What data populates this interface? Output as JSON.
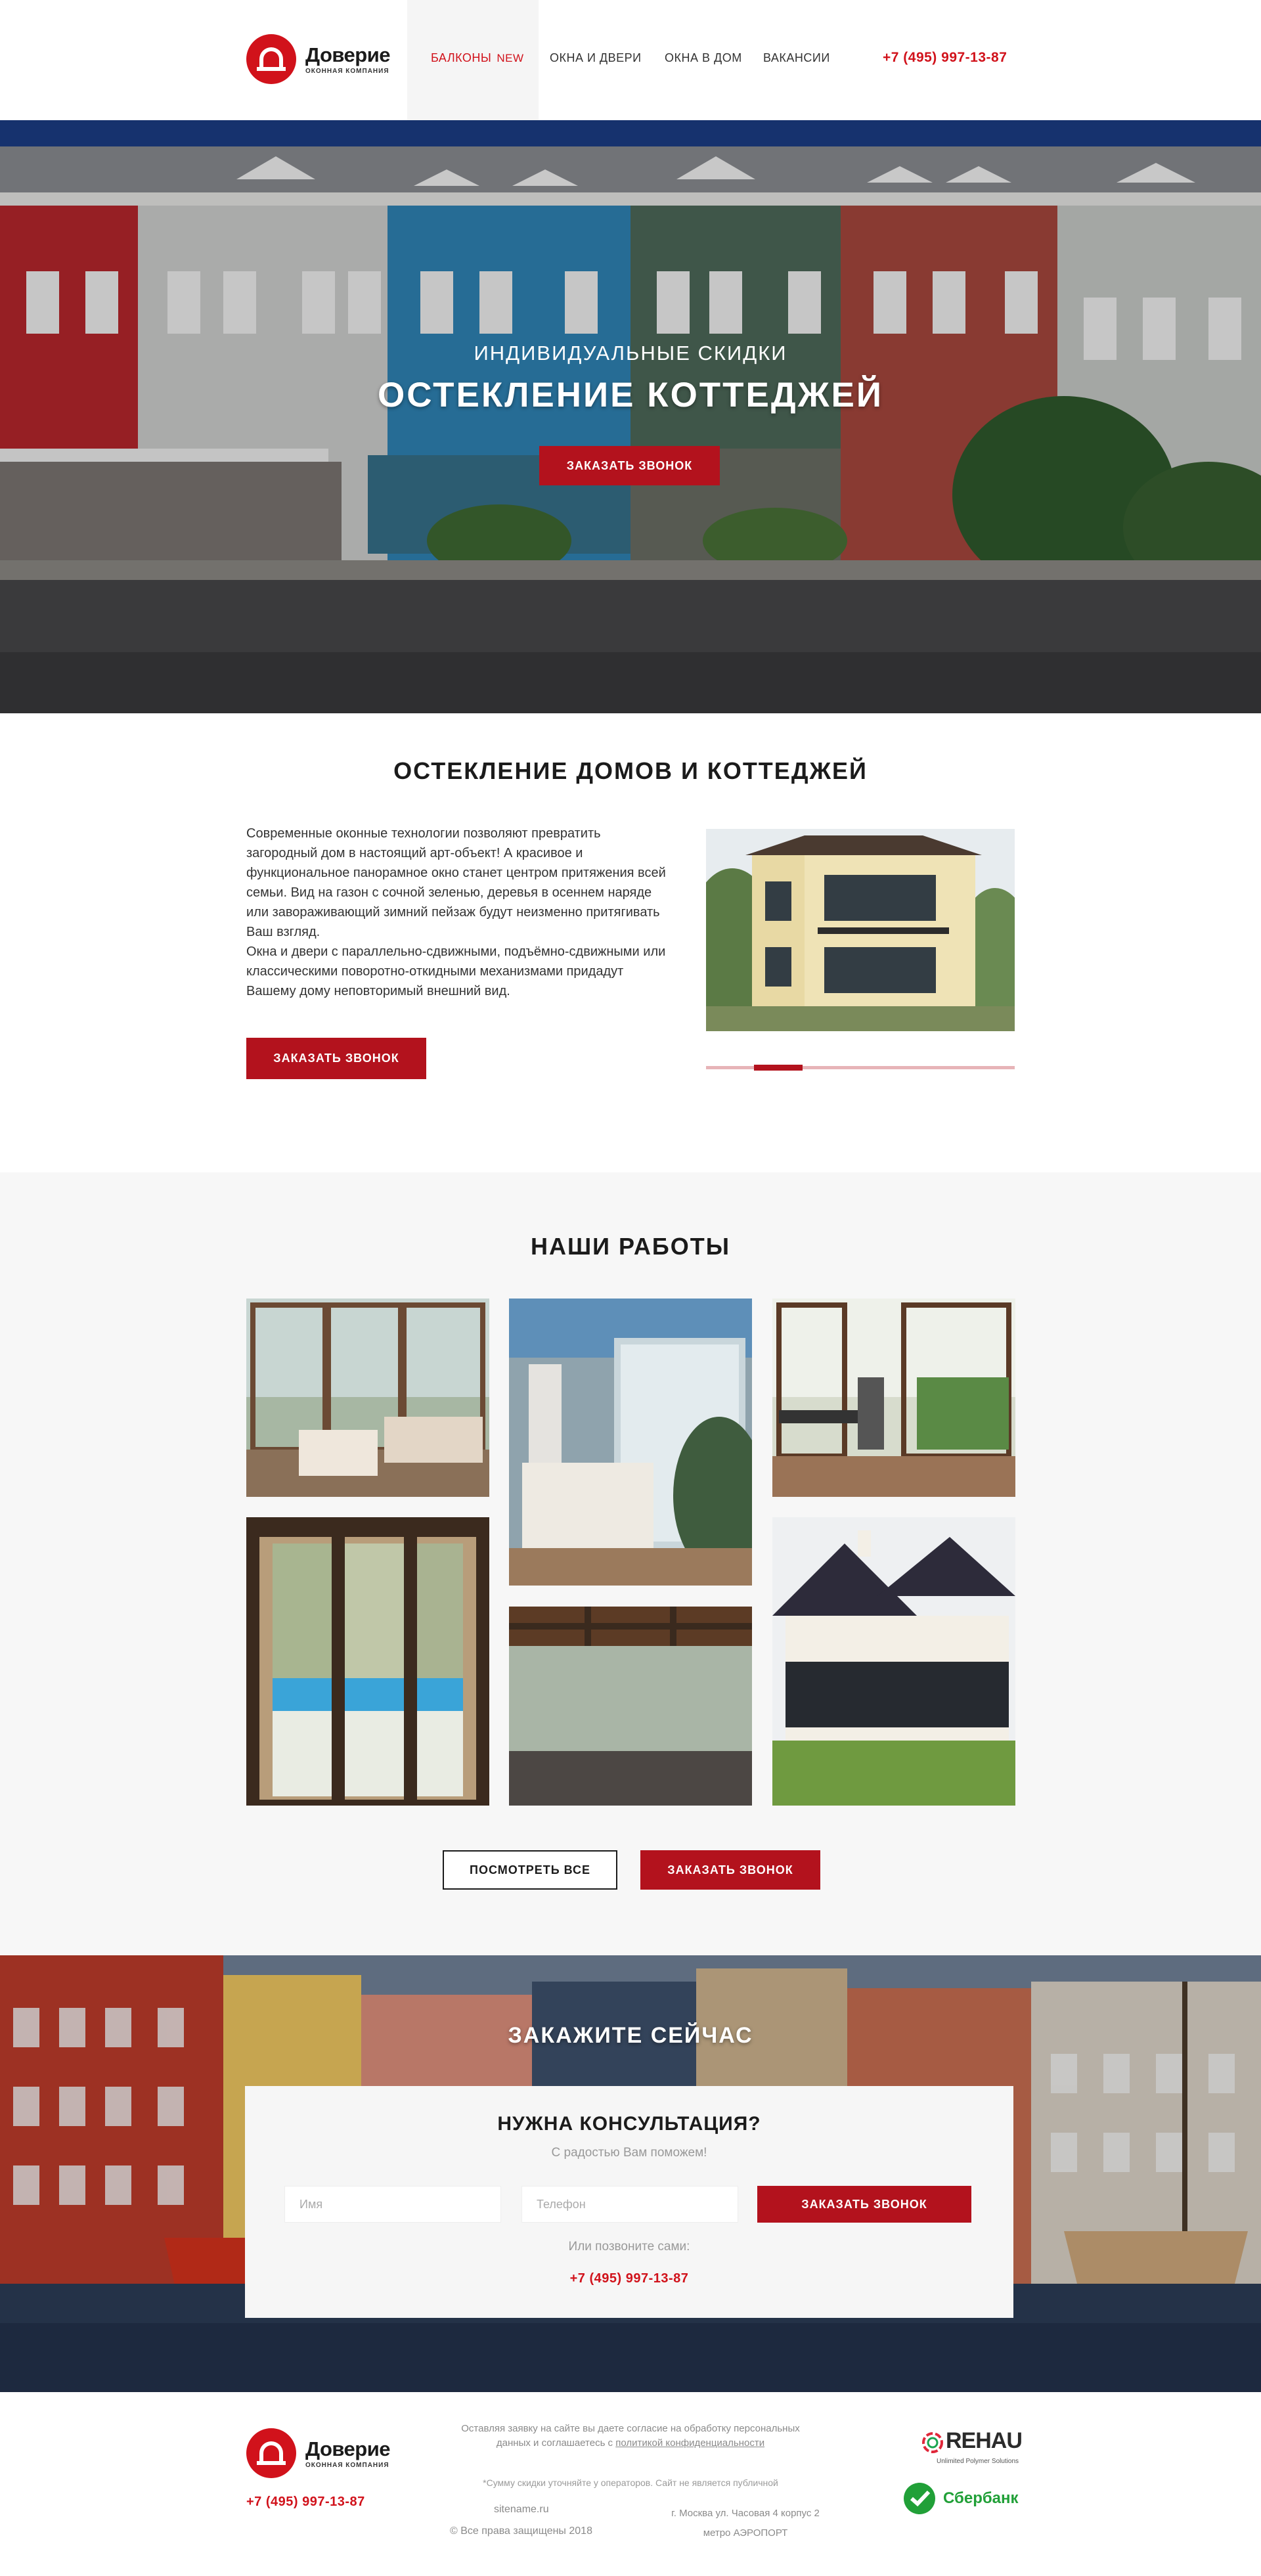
{
  "header": {
    "logo_name": "Доверие",
    "logo_sub": "оконная компания",
    "nav": {
      "balconies": "Балконы",
      "balconies_badge": "NEW",
      "windows_doors": "Окна и двери",
      "windows_home": "Окна в дом",
      "vacancies": "Вакансии"
    },
    "phone": "+7 (495) 997-13-87"
  },
  "hero": {
    "subtitle": "Индивидуальные скидки",
    "title": "Остекление коттеджей",
    "button": "Заказать звонок"
  },
  "about": {
    "title": "Остекление домов и коттеджей",
    "paragraph_1": "Современные оконные технологии позволяют превратить загородный дом в настоящий арт-объект! А красивое и функциональное панорамное окно станет центром притяжения всей семьи. Вид на газон с сочной зеленью, деревья в осеннем наряде или завораживающий зимний пейзаж будут неизменно притягивать Ваш взгляд.",
    "paragraph_2": "Окна и двери с параллельно-сдвижными, подъёмно-сдвижными или классическими поворотно-откидными механизмами придадут Вашему дому неповторимый внешний вид.",
    "button": "Заказать звонок"
  },
  "works": {
    "title": "Наши работы",
    "view_all": "Посмотреть все",
    "button": "Заказать звонок"
  },
  "order": {
    "title": "Закажите сейчас",
    "card_title": "Нужна консультация?",
    "card_sub": "С радостью Вам поможем!",
    "name_placeholder": "Имя",
    "phone_placeholder": "Телефон",
    "button": "Заказать звонок",
    "call_text": "Или позвоните сами:",
    "phone": "+7 (495) 997-13-87"
  },
  "footer": {
    "logo_name": "Доверие",
    "logo_sub": "оконная компания",
    "phone": "+7 (495) 997-13-87",
    "legal_text": "Оставляя заявку на сайте вы даете согласие на обработку персональных данных и соглашаетесь с",
    "legal_link": "политикой конфиденциальности",
    "note": "*Сумму скидки уточняйте у операторов. Сайт не является публичной",
    "site": "sitename.ru",
    "copyright": "© Все права защищены 2018",
    "address": "г. Москва ул. Часовая 4 корпус 2",
    "metro": "метро АЭРОПОРТ",
    "rehau": "REHAU",
    "rehau_sub": "Unlimited Polymer Solutions",
    "sber": "Сбербанк"
  },
  "colors": {
    "brand_red": "#d1121b",
    "button_red": "#b3121d",
    "section_gray": "#f7f7f7"
  }
}
